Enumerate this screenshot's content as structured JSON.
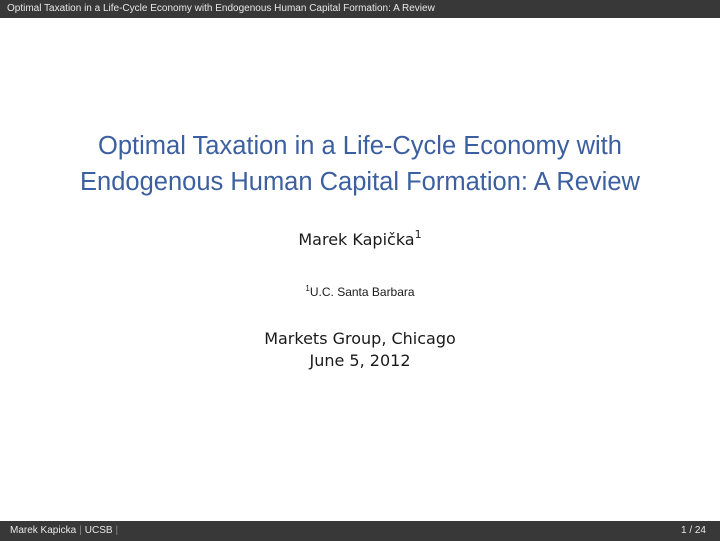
{
  "header": {
    "running_title": "Optimal Taxation in a Life-Cycle Economy with Endogenous Human Capital Formation: A Review"
  },
  "title_block": {
    "title_line1": "Optimal Taxation in a Life-Cycle Economy with",
    "title_line2": "Endogenous Human Capital Formation: A Review",
    "author": "Marek Kapička",
    "author_mark": "1",
    "affiliation_mark": "1",
    "affiliation": "U.C. Santa Barbara",
    "event": "Markets Group, Chicago",
    "date": "June 5, 2012"
  },
  "footer": {
    "author": "Marek Kapicka",
    "separator": "|",
    "institute": "UCSB",
    "page_current": "1",
    "page_sep": "/",
    "page_total": "24"
  },
  "colors": {
    "bar": "#383838",
    "title": "#3b5fa0"
  }
}
